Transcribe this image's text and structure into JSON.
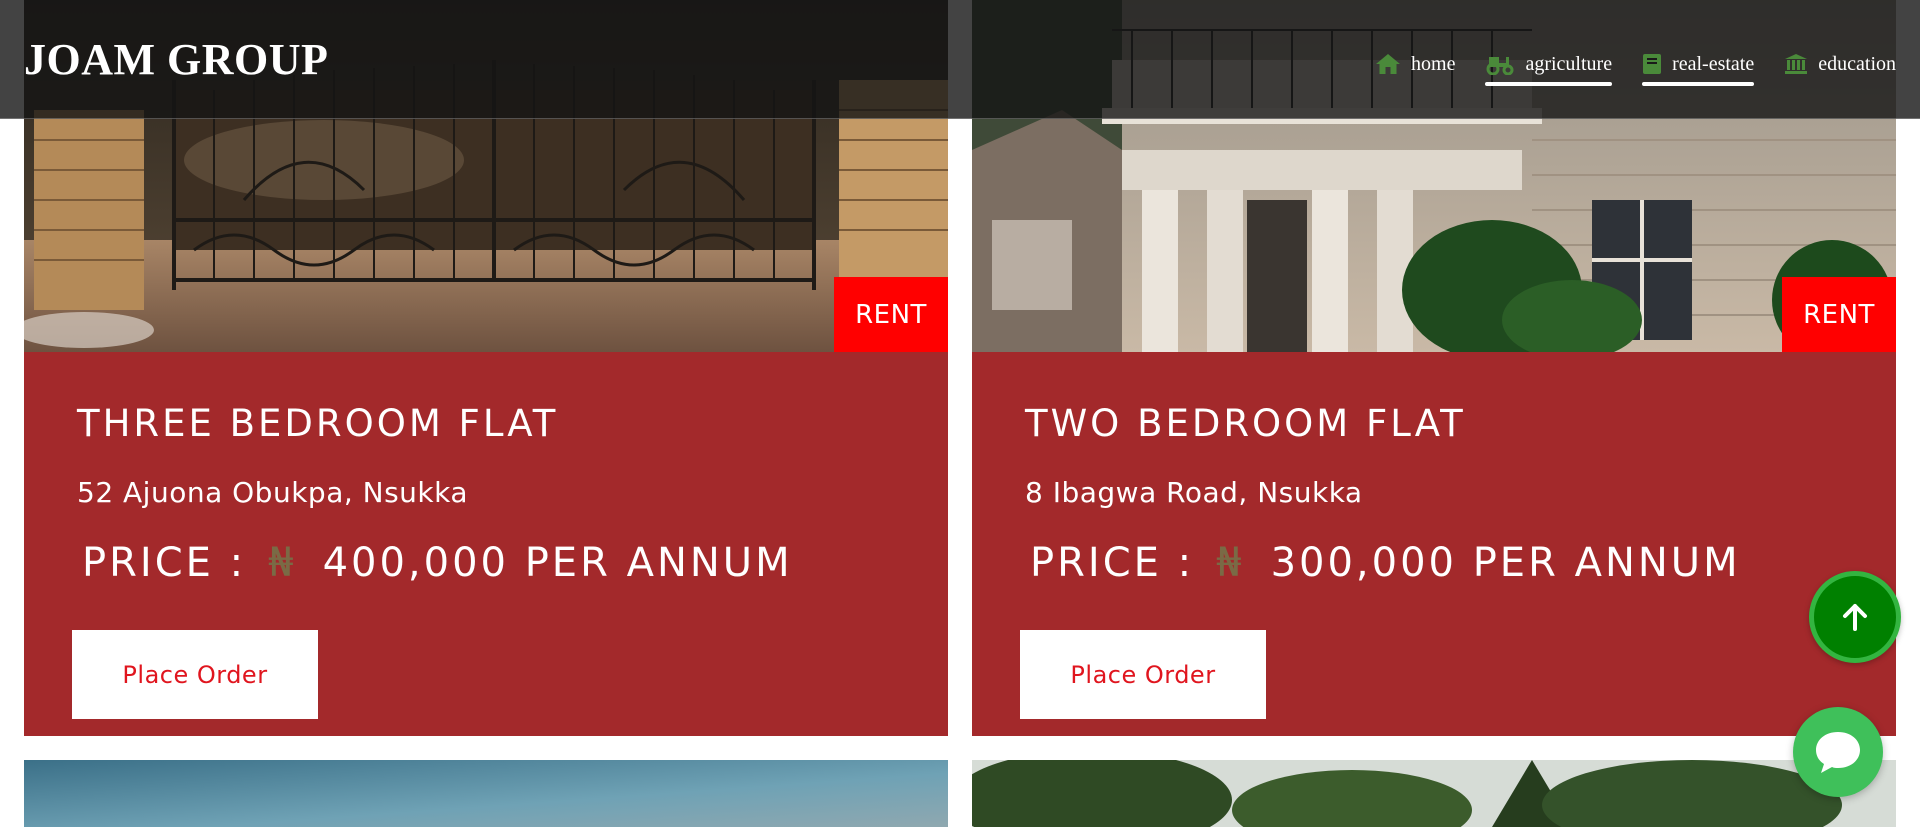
{
  "header": {
    "brand": "JOAM GROUP",
    "nav": [
      {
        "label": "home",
        "icon": "home-icon",
        "active": false
      },
      {
        "label": "agriculture",
        "icon": "tractor-icon",
        "active": true
      },
      {
        "label": "real-estate",
        "icon": "book-icon",
        "active": true
      },
      {
        "label": "education",
        "icon": "institution-icon",
        "active": false
      }
    ]
  },
  "listings": [
    {
      "badge": "RENT",
      "title": "THREE BEDROOM FLAT",
      "address": "52 Ajuona Obukpa, Nsukka",
      "price_label": "PRICE :",
      "currency": "₦",
      "price_value": "400,000 PER ANNUM",
      "button": "Place Order"
    },
    {
      "badge": "RENT",
      "title": "TWO BEDROOM FLAT",
      "address": "8 Ibagwa Road, Nsukka",
      "price_label": "PRICE :",
      "currency": "₦",
      "price_value": "300,000 PER ANNUM",
      "button": "Place Order"
    }
  ],
  "colors": {
    "card_body": "#a3292b",
    "badge": "#ff0000",
    "button_text": "#e0151e",
    "nav_icon": "#4a8a3a",
    "scroll_top": "#008000",
    "chat": "#3fc05a"
  },
  "floating": {
    "scroll_top_icon": "arrow-up-icon",
    "chat_icon": "chat-bubble-icon"
  }
}
